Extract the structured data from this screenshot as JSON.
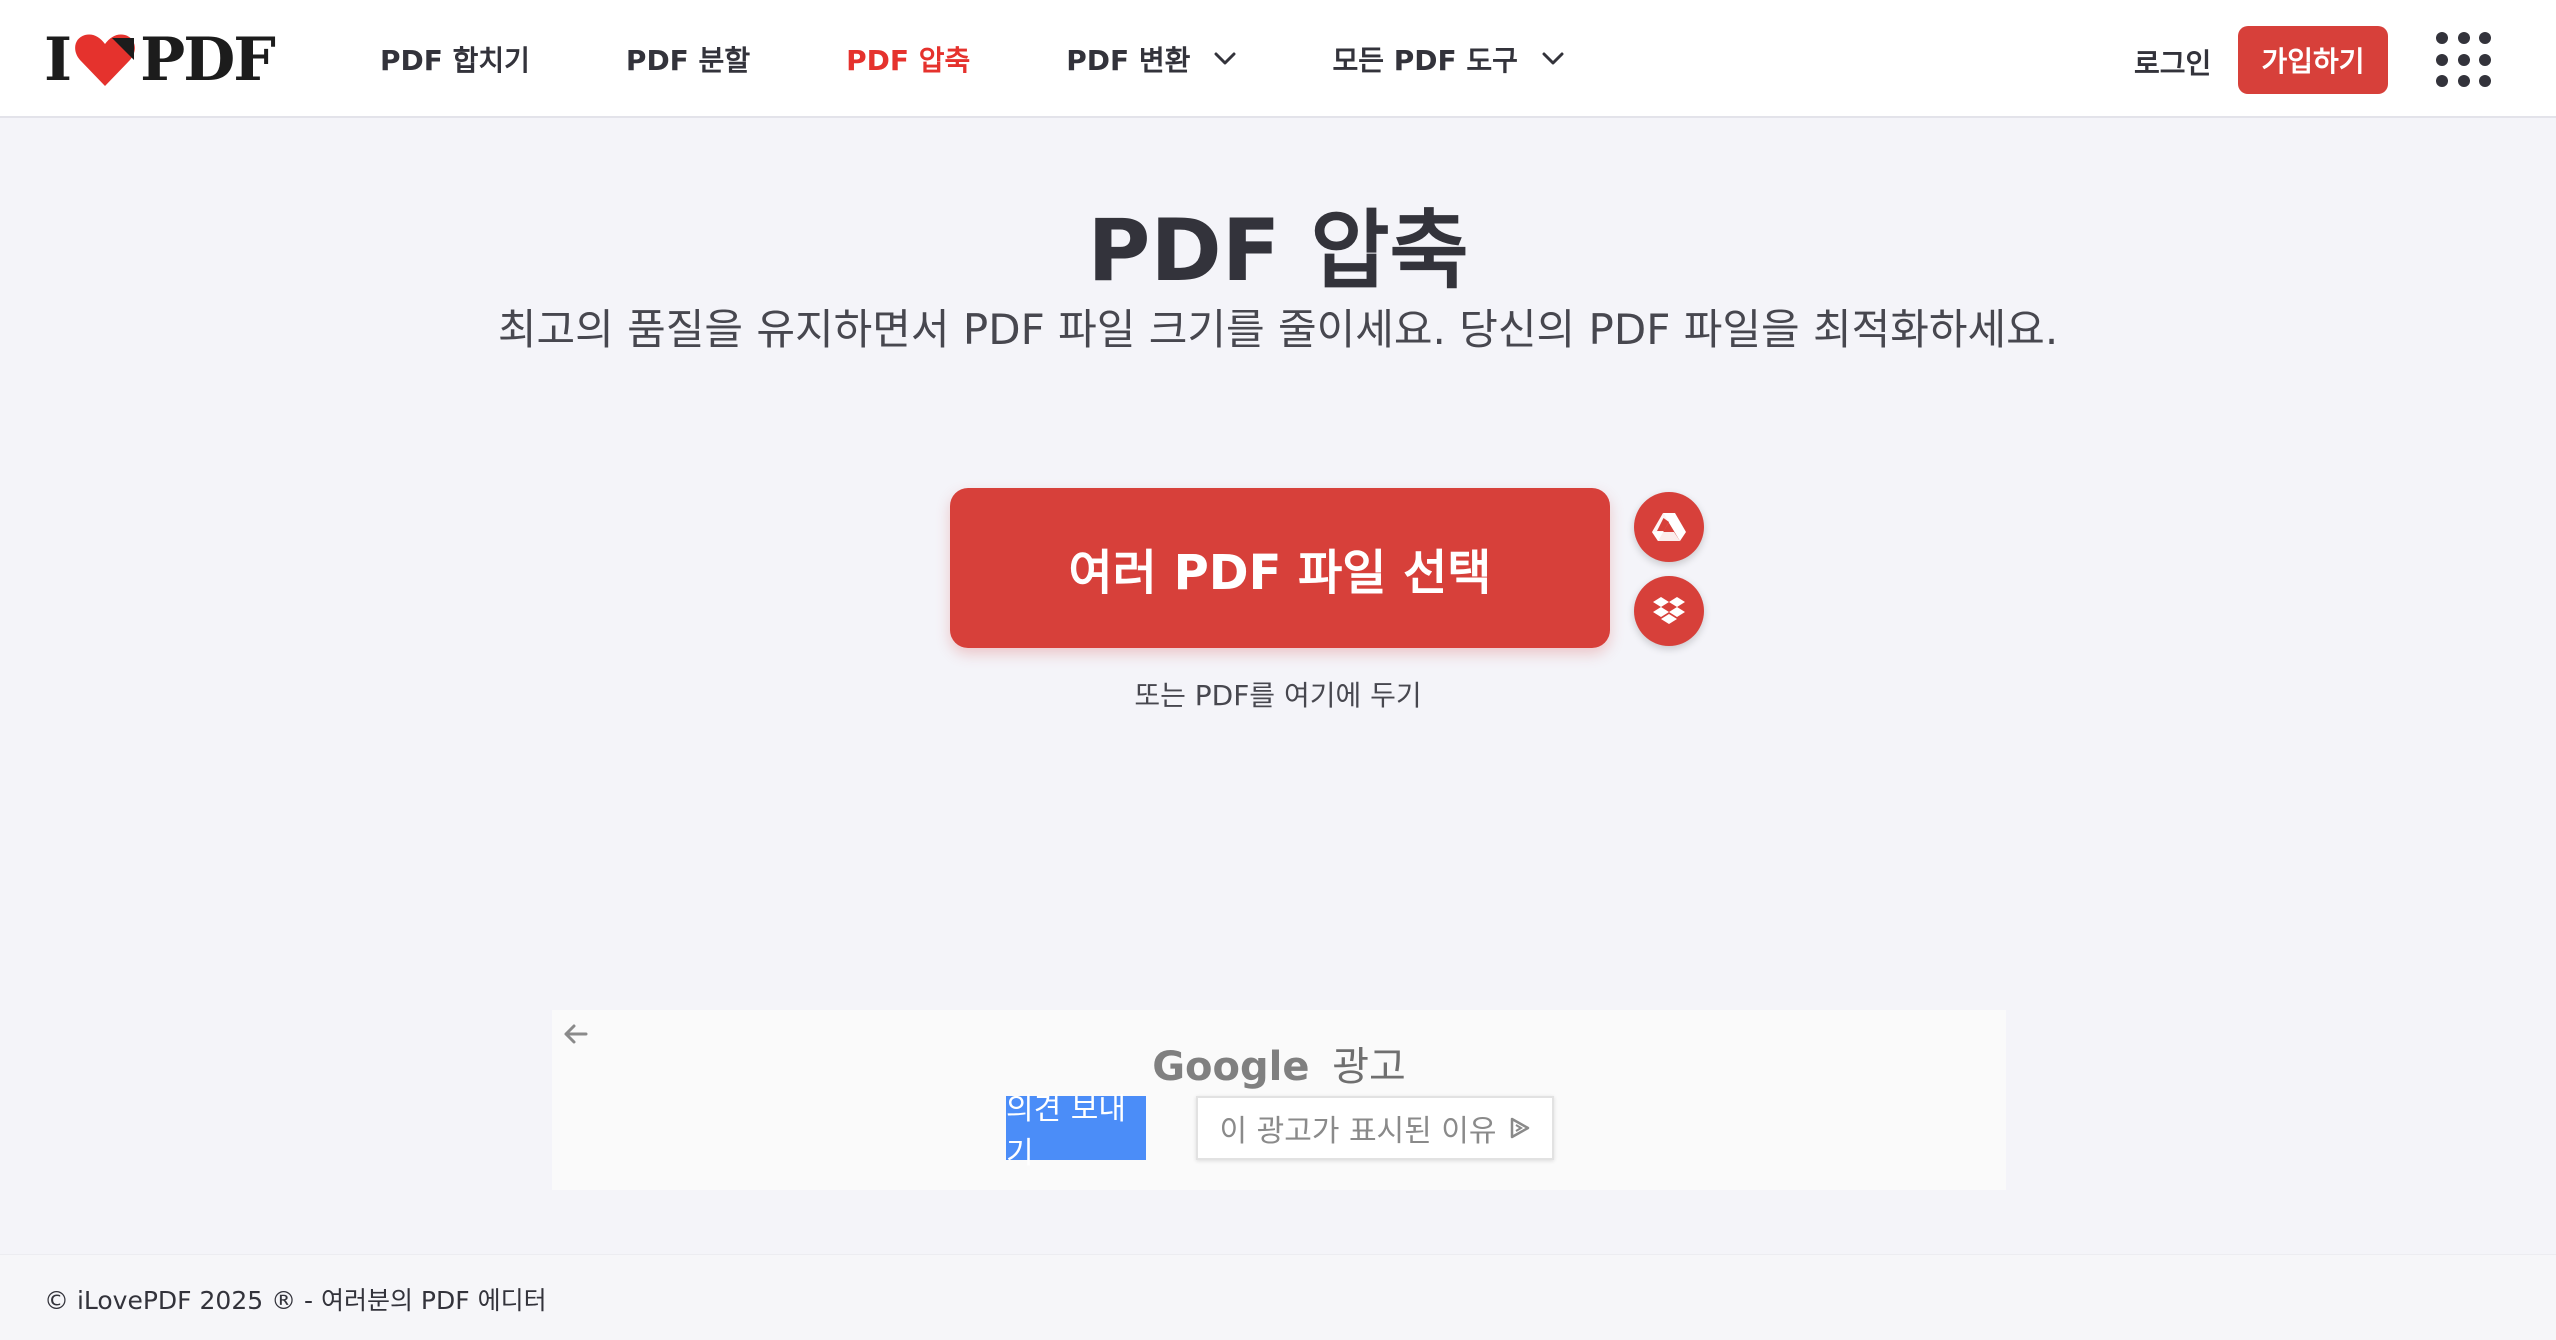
{
  "header": {
    "logo_left": "I",
    "logo_right": "PDF",
    "nav": [
      {
        "label": "PDF 합치기",
        "active": false,
        "dropdown": false
      },
      {
        "label": "PDF 분할",
        "active": false,
        "dropdown": false
      },
      {
        "label": "PDF 압축",
        "active": true,
        "dropdown": false
      },
      {
        "label": "PDF 변환",
        "active": false,
        "dropdown": true
      },
      {
        "label": "모든 PDF 도구",
        "active": false,
        "dropdown": true
      }
    ],
    "login_label": "로그인",
    "signup_label": "가입하기",
    "apps_icon": "apps-grid-icon"
  },
  "main": {
    "title": "PDF 압축",
    "subtitle": "최고의 품질을 유지하면서 PDF 파일 크기를 줄이세요. 당신의 PDF 파일을 최적화하세요.",
    "select_button_label": "여러 PDF 파일 선택",
    "cloud_buttons": [
      "google-drive-icon",
      "dropbox-icon"
    ],
    "drop_hint": "또는 PDF를 여기에 두기"
  },
  "ad": {
    "brand": "Google",
    "label": "광고",
    "feedback_label": "의견 보내기",
    "why_label": "이 광고가 표시된 이유"
  },
  "footer": {
    "text": "© iLovePDF 2025 ® - 여러분의 PDF 에디터"
  },
  "colors": {
    "brand_red": "#d7403a",
    "active_nav": "#e5322d",
    "background": "#f4f4f9",
    "ad_blue": "#4b8df8"
  }
}
